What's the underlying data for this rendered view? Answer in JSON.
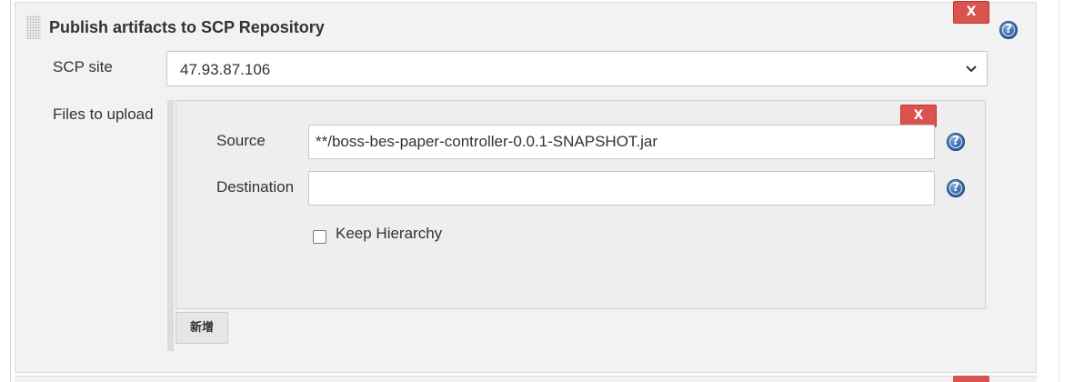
{
  "section": {
    "title": "Publish artifacts to SCP Repository",
    "delete_label": "X",
    "help_label": "?"
  },
  "scp_site": {
    "label": "SCP site",
    "selected": "47.93.87.106"
  },
  "files": {
    "label": "Files to upload",
    "delete_label": "X",
    "source": {
      "label": "Source",
      "value": "**/boss-bes-paper-controller-0.0.1-SNAPSHOT.jar",
      "help_label": "?"
    },
    "destination": {
      "label": "Destination",
      "value": "",
      "help_label": "?"
    },
    "keep_hierarchy": {
      "label": "Keep Hierarchy",
      "checked": false
    },
    "add_label": "新增"
  },
  "colors": {
    "delete_button": "#d9534f",
    "help_icon": "#3a6cb0",
    "panel_bg": "#f2f2f2"
  }
}
